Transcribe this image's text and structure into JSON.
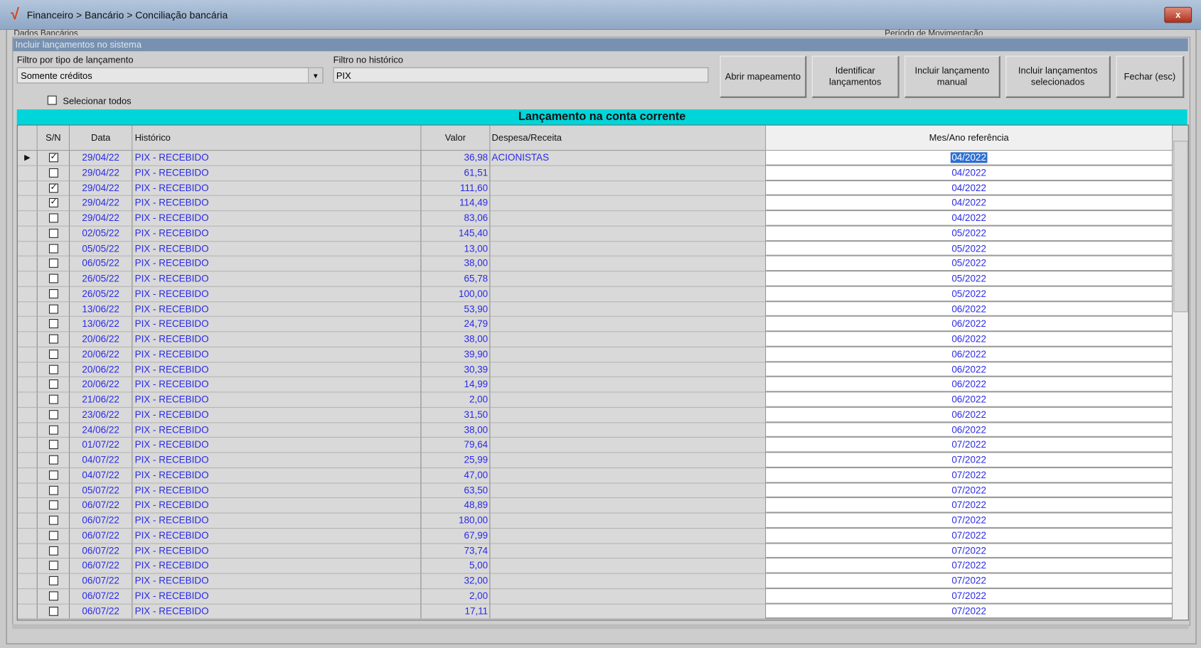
{
  "window": {
    "title": "Financeiro > Bancário > Conciliação bancária",
    "close_label": "x",
    "cut_label_left": "Dados Bancários",
    "cut_label_right": "Período de Movimentação"
  },
  "group": {
    "title": "Incluir lançamentos no sistema"
  },
  "filters": {
    "type_label": "Filtro por tipo de lançamento",
    "type_value": "Somente créditos",
    "history_label": "Filtro no histórico",
    "history_value": "PIX",
    "select_all_label": "Selecionar todos"
  },
  "buttons": {
    "open_mapping": "Abrir mapeamento",
    "identify": "Identificar lançamentos",
    "manual": "Incluir lançamento manual",
    "include_selected": "Incluir lançamentos selecionados",
    "close": "Fechar (esc)"
  },
  "grid": {
    "title": "Lançamento na conta corrente",
    "columns": {
      "sn": "S/N",
      "data": "Data",
      "historico": "Histórico",
      "valor": "Valor",
      "despesa": "Despesa/Receita",
      "mes": "Mes/Ano referência"
    },
    "rows": [
      {
        "checked": true,
        "data": "29/04/22",
        "historico": "PIX - RECEBIDO",
        "valor": "36,98",
        "despesa": "ACIONISTAS",
        "mes": "04/2022"
      },
      {
        "checked": false,
        "data": "29/04/22",
        "historico": "PIX - RECEBIDO",
        "valor": "61,51",
        "despesa": "",
        "mes": "04/2022"
      },
      {
        "checked": true,
        "data": "29/04/22",
        "historico": "PIX - RECEBIDO",
        "valor": "111,60",
        "despesa": "",
        "mes": "04/2022"
      },
      {
        "checked": true,
        "data": "29/04/22",
        "historico": "PIX - RECEBIDO",
        "valor": "114,49",
        "despesa": "",
        "mes": "04/2022"
      },
      {
        "checked": false,
        "data": "29/04/22",
        "historico": "PIX - RECEBIDO",
        "valor": "83,06",
        "despesa": "",
        "mes": "04/2022"
      },
      {
        "checked": false,
        "data": "02/05/22",
        "historico": "PIX - RECEBIDO",
        "valor": "145,40",
        "despesa": "",
        "mes": "05/2022"
      },
      {
        "checked": false,
        "data": "05/05/22",
        "historico": "PIX - RECEBIDO",
        "valor": "13,00",
        "despesa": "",
        "mes": "05/2022"
      },
      {
        "checked": false,
        "data": "06/05/22",
        "historico": "PIX - RECEBIDO",
        "valor": "38,00",
        "despesa": "",
        "mes": "05/2022"
      },
      {
        "checked": false,
        "data": "26/05/22",
        "historico": "PIX - RECEBIDO",
        "valor": "65,78",
        "despesa": "",
        "mes": "05/2022"
      },
      {
        "checked": false,
        "data": "26/05/22",
        "historico": "PIX - RECEBIDO",
        "valor": "100,00",
        "despesa": "",
        "mes": "05/2022"
      },
      {
        "checked": false,
        "data": "13/06/22",
        "historico": "PIX - RECEBIDO",
        "valor": "53,90",
        "despesa": "",
        "mes": "06/2022"
      },
      {
        "checked": false,
        "data": "13/06/22",
        "historico": "PIX - RECEBIDO",
        "valor": "24,79",
        "despesa": "",
        "mes": "06/2022"
      },
      {
        "checked": false,
        "data": "20/06/22",
        "historico": "PIX - RECEBIDO",
        "valor": "38,00",
        "despesa": "",
        "mes": "06/2022"
      },
      {
        "checked": false,
        "data": "20/06/22",
        "historico": "PIX - RECEBIDO",
        "valor": "39,90",
        "despesa": "",
        "mes": "06/2022"
      },
      {
        "checked": false,
        "data": "20/06/22",
        "historico": "PIX - RECEBIDO",
        "valor": "30,39",
        "despesa": "",
        "mes": "06/2022"
      },
      {
        "checked": false,
        "data": "20/06/22",
        "historico": "PIX - RECEBIDO",
        "valor": "14,99",
        "despesa": "",
        "mes": "06/2022"
      },
      {
        "checked": false,
        "data": "21/06/22",
        "historico": "PIX - RECEBIDO",
        "valor": "2,00",
        "despesa": "",
        "mes": "06/2022"
      },
      {
        "checked": false,
        "data": "23/06/22",
        "historico": "PIX - RECEBIDO",
        "valor": "31,50",
        "despesa": "",
        "mes": "06/2022"
      },
      {
        "checked": false,
        "data": "24/06/22",
        "historico": "PIX - RECEBIDO",
        "valor": "38,00",
        "despesa": "",
        "mes": "06/2022"
      },
      {
        "checked": false,
        "data": "01/07/22",
        "historico": "PIX - RECEBIDO",
        "valor": "79,64",
        "despesa": "",
        "mes": "07/2022"
      },
      {
        "checked": false,
        "data": "04/07/22",
        "historico": "PIX - RECEBIDO",
        "valor": "25,99",
        "despesa": "",
        "mes": "07/2022"
      },
      {
        "checked": false,
        "data": "04/07/22",
        "historico": "PIX - RECEBIDO",
        "valor": "47,00",
        "despesa": "",
        "mes": "07/2022"
      },
      {
        "checked": false,
        "data": "05/07/22",
        "historico": "PIX - RECEBIDO",
        "valor": "63,50",
        "despesa": "",
        "mes": "07/2022"
      },
      {
        "checked": false,
        "data": "06/07/22",
        "historico": "PIX - RECEBIDO",
        "valor": "48,89",
        "despesa": "",
        "mes": "07/2022"
      },
      {
        "checked": false,
        "data": "06/07/22",
        "historico": "PIX - RECEBIDO",
        "valor": "180,00",
        "despesa": "",
        "mes": "07/2022"
      },
      {
        "checked": false,
        "data": "06/07/22",
        "historico": "PIX - RECEBIDO",
        "valor": "67,99",
        "despesa": "",
        "mes": "07/2022"
      },
      {
        "checked": false,
        "data": "06/07/22",
        "historico": "PIX - RECEBIDO",
        "valor": "73,74",
        "despesa": "",
        "mes": "07/2022"
      },
      {
        "checked": false,
        "data": "06/07/22",
        "historico": "PIX - RECEBIDO",
        "valor": "5,00",
        "despesa": "",
        "mes": "07/2022"
      },
      {
        "checked": false,
        "data": "06/07/22",
        "historico": "PIX - RECEBIDO",
        "valor": "32,00",
        "despesa": "",
        "mes": "07/2022"
      },
      {
        "checked": false,
        "data": "06/07/22",
        "historico": "PIX - RECEBIDO",
        "valor": "2,00",
        "despesa": "",
        "mes": "07/2022"
      },
      {
        "checked": false,
        "data": "06/07/22",
        "historico": "PIX - RECEBIDO",
        "valor": "17,11",
        "despesa": "",
        "mes": "07/2022"
      }
    ]
  }
}
